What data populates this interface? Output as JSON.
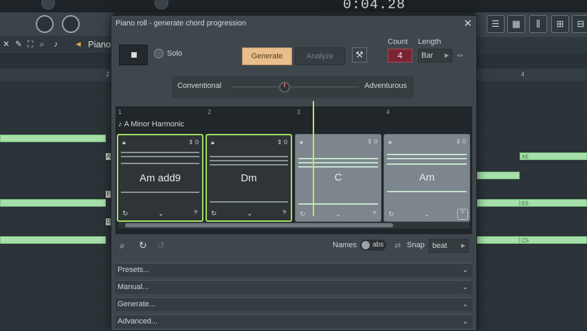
{
  "background": {
    "transport_time": "0:04.28",
    "piano_roll_title": "Piano",
    "ruler_marks": [
      "2",
      "4"
    ],
    "note_labels": [
      "A5",
      "E5",
      "C5"
    ],
    "key_tags": [
      "A",
      "F",
      "D"
    ]
  },
  "dialog": {
    "title": "Piano roll - generate chord progression",
    "close_icon": "close-icon",
    "solo_label": "Solo",
    "generate_label": "Generate",
    "analyze_label": "Analyze",
    "count_label": "Count",
    "count_value": "4",
    "length_label": "Length",
    "length_value": "Bar",
    "slider_left": "Conventional",
    "slider_right": "Adventurous",
    "ruler": [
      "1",
      "2",
      "3",
      "4"
    ],
    "key": "A Minor Harmonic",
    "chords": [
      {
        "name": "Am add9",
        "count": "0"
      },
      {
        "name": "Dm",
        "count": "0"
      },
      {
        "name": "C",
        "count": "0"
      },
      {
        "name": "Am",
        "count": "0"
      }
    ],
    "names_label": "Names",
    "names_toggle": "abs",
    "snap_label": "Snap",
    "snap_value": "beat",
    "sections": [
      "Presets...",
      "Manual...",
      "Generate...",
      "Advanced..."
    ]
  },
  "colors": {
    "generate_button": "#e8be8a",
    "count_box": "#7a2433",
    "selected_outline": "#a6e25f",
    "note": "#a6dfa9"
  }
}
